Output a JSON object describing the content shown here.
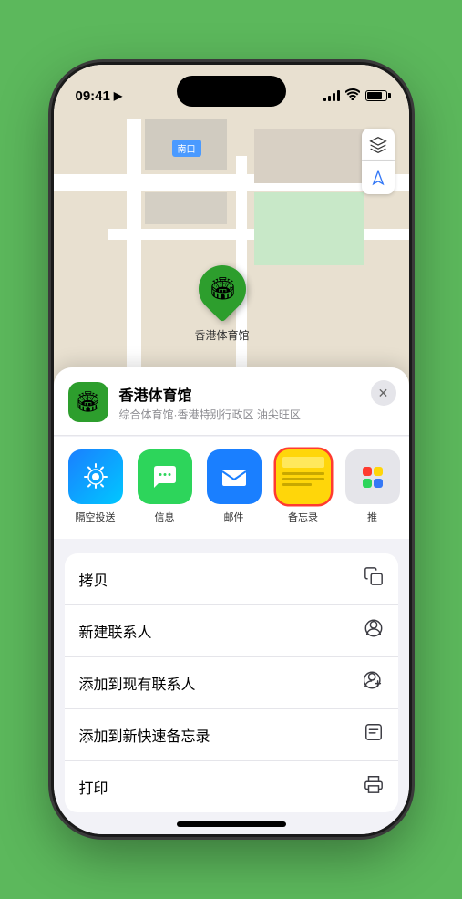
{
  "status_bar": {
    "time": "09:41",
    "location_icon": "▶"
  },
  "map": {
    "label": "南口",
    "map_btn_layers": "🗺",
    "map_btn_location": "↗"
  },
  "venue": {
    "name": "香港体育馆",
    "description": "综合体育馆·香港特别行政区 油尖旺区",
    "icon": "🏟",
    "close_label": "✕"
  },
  "share_items": [
    {
      "id": "airdrop",
      "label": "隔空投送",
      "type": "airdrop"
    },
    {
      "id": "messages",
      "label": "信息",
      "type": "messages"
    },
    {
      "id": "mail",
      "label": "邮件",
      "type": "mail"
    },
    {
      "id": "notes",
      "label": "备忘录",
      "type": "notes"
    },
    {
      "id": "more",
      "label": "推",
      "type": "more"
    }
  ],
  "actions": [
    {
      "id": "copy",
      "label": "拷贝",
      "icon": "copy"
    },
    {
      "id": "new-contact",
      "label": "新建联系人",
      "icon": "person-add"
    },
    {
      "id": "add-existing",
      "label": "添加到现有联系人",
      "icon": "person-circle-add"
    },
    {
      "id": "add-note",
      "label": "添加到新快速备忘录",
      "icon": "note"
    },
    {
      "id": "print",
      "label": "打印",
      "icon": "print"
    }
  ],
  "marker_label": "香港体育馆"
}
